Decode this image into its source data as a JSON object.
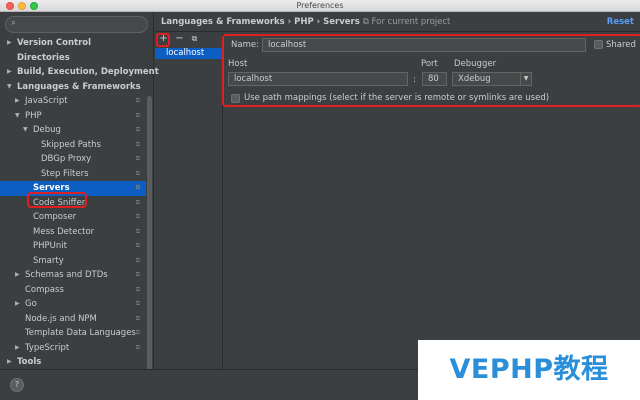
{
  "window": {
    "title": "Preferences"
  },
  "sidebar": {
    "search_placeholder": "",
    "items": [
      {
        "label": "Version Control",
        "bold": true,
        "level": 0,
        "arrow": "right",
        "proj": false
      },
      {
        "label": "Directories",
        "bold": true,
        "level": 0,
        "arrow": "",
        "proj": false
      },
      {
        "label": "Build, Execution, Deployment",
        "bold": true,
        "level": 0,
        "arrow": "right",
        "proj": false
      },
      {
        "label": "Languages & Frameworks",
        "bold": true,
        "level": 0,
        "arrow": "down",
        "proj": false
      },
      {
        "label": "JavaScript",
        "bold": false,
        "level": 1,
        "arrow": "right",
        "proj": true
      },
      {
        "label": "PHP",
        "bold": false,
        "level": 1,
        "arrow": "down",
        "proj": true
      },
      {
        "label": "Debug",
        "bold": false,
        "level": 2,
        "arrow": "down",
        "proj": true
      },
      {
        "label": "Skipped Paths",
        "bold": false,
        "level": 3,
        "arrow": "",
        "proj": true
      },
      {
        "label": "DBGp Proxy",
        "bold": false,
        "level": 3,
        "arrow": "",
        "proj": true
      },
      {
        "label": "Step Filters",
        "bold": false,
        "level": 3,
        "arrow": "",
        "proj": true
      },
      {
        "label": "Servers",
        "bold": true,
        "level": 2,
        "arrow": "",
        "proj": true,
        "selected": true
      },
      {
        "label": "Code Sniffer",
        "bold": false,
        "level": 2,
        "arrow": "",
        "proj": true
      },
      {
        "label": "Composer",
        "bold": false,
        "level": 2,
        "arrow": "",
        "proj": true
      },
      {
        "label": "Mess Detector",
        "bold": false,
        "level": 2,
        "arrow": "",
        "proj": true
      },
      {
        "label": "PHPUnit",
        "bold": false,
        "level": 2,
        "arrow": "",
        "proj": true
      },
      {
        "label": "Smarty",
        "bold": false,
        "level": 2,
        "arrow": "",
        "proj": true
      },
      {
        "label": "Schemas and DTDs",
        "bold": false,
        "level": 1,
        "arrow": "right",
        "proj": true
      },
      {
        "label": "Compass",
        "bold": false,
        "level": 1,
        "arrow": "",
        "proj": true
      },
      {
        "label": "Go",
        "bold": false,
        "level": 1,
        "arrow": "right",
        "proj": true
      },
      {
        "label": "Node.js and NPM",
        "bold": false,
        "level": 1,
        "arrow": "",
        "proj": true
      },
      {
        "label": "Template Data Languages",
        "bold": false,
        "level": 1,
        "arrow": "",
        "proj": true
      },
      {
        "label": "TypeScript",
        "bold": false,
        "level": 1,
        "arrow": "right",
        "proj": true
      },
      {
        "label": "Tools",
        "bold": true,
        "level": 0,
        "arrow": "right",
        "proj": false
      }
    ]
  },
  "header": {
    "breadcrumb": "Languages & Frameworks › PHP › Servers",
    "scope": "For current project",
    "reset_label": "Reset"
  },
  "servers": {
    "toolbar": {
      "add": "+",
      "remove": "−",
      "copy": "⧉"
    },
    "items": [
      "localhost"
    ]
  },
  "form": {
    "name_label": "Name:",
    "name_value": "localhost",
    "shared_label": "Shared",
    "host_label": "Host",
    "host_value": "localhost",
    "port_label": "Port",
    "port_sep": ":",
    "port_value": "80",
    "debugger_label": "Debugger",
    "debugger_value": "Xdebug",
    "path_mappings_label": "Use path mappings (select if the server is remote or symlinks are used)"
  },
  "bottom": {
    "help": "?"
  },
  "watermark": {
    "text": "VEPHP教程"
  }
}
